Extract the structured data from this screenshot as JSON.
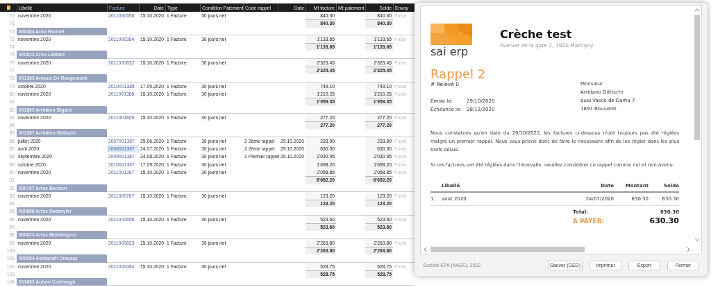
{
  "sheet": {
    "columns": [
      {
        "label": "Libellé",
        "sorted": false
      },
      {
        "label": "Facture",
        "sorted": true
      },
      {
        "label": "Date",
        "sorted": false
      },
      {
        "label": "Type",
        "sorted": false
      },
      {
        "label": "Condition Paiement",
        "sorted": false
      },
      {
        "label": "Code rappel",
        "sorted": false
      },
      {
        "label": "Date",
        "sorted": false
      },
      {
        "label": "Mt facture",
        "sorted": false
      },
      {
        "label": "Mt paiement",
        "sorted": false
      },
      {
        "label": "Solde",
        "sorted": false
      },
      {
        "label": "Envoy",
        "sorted": false
      }
    ],
    "rows": [
      {
        "number": "70",
        "kind": "invoice",
        "libelle": "novembre 2020",
        "facture": "2011000556",
        "date": "15.10.2020",
        "type": "1 Facture",
        "condition": "30 jours net",
        "mt_facture": "840.30",
        "solde": "840.30",
        "envoye": "Poste",
        "selected": false
      },
      {
        "number": "71",
        "kind": "total",
        "mt_facture": "840.30",
        "solde": "840.30"
      },
      {
        "number": "72",
        "kind": "group",
        "label": "000384 Arno Rouriet"
      },
      {
        "number": "73",
        "kind": "invoice",
        "libelle": "novembre 2020",
        "facture": "2011000384",
        "date": "15.10.2020",
        "type": "1 Facture",
        "condition": "30 jours net",
        "mt_facture": "1'133.65",
        "solde": "1'133.65",
        "envoye": "Poste",
        "selected": false
      },
      {
        "number": "74",
        "kind": "total",
        "mt_facture": "1'133.65",
        "solde": "1'133.65"
      },
      {
        "number": "75",
        "kind": "group",
        "label": "000832 Arno Laillard"
      },
      {
        "number": "76",
        "kind": "invoice",
        "libelle": "novembre 2020",
        "facture": "2011000832",
        "date": "15.10.2020",
        "type": "1 Facture",
        "condition": "30 jours net",
        "mt_facture": "2'325.45",
        "solde": "2'325.45",
        "envoye": "Poste",
        "selected": false
      },
      {
        "number": "77",
        "kind": "total",
        "mt_facture": "2'325.45",
        "solde": "2'325.45"
      },
      {
        "number": "78",
        "kind": "group",
        "label": "001385 Arnoux De Rougemont"
      },
      {
        "number": "79",
        "kind": "invoice",
        "libelle": "octobre 2020",
        "facture": "2010001385",
        "date": "17.09.2020",
        "type": "1 Facture",
        "condition": "30 jours net",
        "mt_facture": "749.10",
        "solde": "749.10",
        "envoye": "Poste",
        "selected": false
      },
      {
        "number": "80",
        "kind": "invoice",
        "libelle": "novembre 2020",
        "facture": "2011001385",
        "date": "15.10.2020",
        "type": "1 Facture",
        "condition": "30 jours net",
        "mt_facture": "1'210.25",
        "solde": "1'210.25",
        "envoye": "Poste",
        "selected": false
      },
      {
        "number": "81",
        "kind": "total",
        "mt_facture": "1'959.35",
        "solde": "1'959.35"
      },
      {
        "number": "82",
        "kind": "group",
        "label": "001809 Arridano Bigard"
      },
      {
        "number": "83",
        "kind": "invoice",
        "libelle": "novembre 2020",
        "facture": "2011001809",
        "date": "15.10.2020",
        "type": "1 Facture",
        "condition": "30 jours net",
        "mt_facture": "277.20",
        "solde": "277.20",
        "envoye": "Poste",
        "selected": false
      },
      {
        "number": "84",
        "kind": "total",
        "mt_facture": "277.20",
        "solde": "277.20"
      },
      {
        "number": "85",
        "kind": "group",
        "label": "001367 Arridano Göttschi"
      },
      {
        "number": "86",
        "kind": "invoice",
        "libelle": "juillet 2020",
        "facture": "2007001367",
        "date": "25.06.2020",
        "type": "1 Facture",
        "condition": "30 jours net",
        "code_rappel": "2 2ème rappel",
        "date_rappel": "29.10.2020",
        "mt_facture": "233.90",
        "solde": "233.90",
        "envoye": "Poste",
        "selected": false
      },
      {
        "number": "87",
        "kind": "invoice",
        "libelle": "août 2020",
        "facture": "2008001367",
        "date": "24.07.2020",
        "type": "1 Facture",
        "condition": "30 jours net",
        "code_rappel": "2 2ème rappel",
        "date_rappel": "29.10.2020",
        "mt_facture": "630.30",
        "solde": "630.30",
        "envoye": "Poste",
        "selected": true
      },
      {
        "number": "88",
        "kind": "invoice",
        "libelle": "septembre 2020",
        "facture": "2009001367",
        "date": "24.08.2020",
        "type": "1 Facture",
        "condition": "30 jours net",
        "code_rappel": "1 Premier rappel",
        "date_rappel": "29.10.2020",
        "mt_facture": "2'030.95",
        "solde": "2'030.95",
        "envoye": "Poste",
        "selected": false
      },
      {
        "number": "89",
        "kind": "invoice",
        "libelle": "octobre 2020",
        "facture": "2010001367",
        "date": "17.09.2020",
        "type": "1 Facture",
        "condition": "30 jours net",
        "mt_facture": "1'698.20",
        "solde": "1'698.20",
        "envoye": "Poste",
        "selected": false
      },
      {
        "number": "90",
        "kind": "invoice",
        "libelle": "novembre 2020",
        "facture": "2011001367",
        "date": "15.10.2020",
        "type": "1 Facture",
        "condition": "30 jours net",
        "mt_facture": "2'058.85",
        "solde": "2'058.85",
        "envoye": "Poste",
        "selected": false
      },
      {
        "number": "91",
        "kind": "total",
        "mt_facture": "6'652.20",
        "solde": "6'652.20"
      },
      {
        "number": "92",
        "kind": "group",
        "label": "000767 Artos Barbieri"
      },
      {
        "number": "93",
        "kind": "invoice",
        "libelle": "novembre 2020",
        "facture": "2011000767",
        "date": "15.10.2020",
        "type": "1 Facture",
        "condition": "30 jours net",
        "mt_facture": "123.20",
        "solde": "123.20",
        "envoye": "Poste",
        "selected": false
      },
      {
        "number": "94",
        "kind": "total",
        "mt_facture": "123.20",
        "solde": "123.20"
      },
      {
        "number": "95",
        "kind": "group",
        "label": "000698 Artos Daetwyler"
      },
      {
        "number": "96",
        "kind": "invoice",
        "libelle": "novembre 2020",
        "facture": "2011000698",
        "date": "15.10.2020",
        "type": "1 Facture",
        "condition": "30 jours net",
        "mt_facture": "523.60",
        "solde": "523.60",
        "envoye": "Poste",
        "selected": false
      },
      {
        "number": "97",
        "kind": "total",
        "mt_facture": "523.60",
        "solde": "523.60"
      },
      {
        "number": "98",
        "kind": "group",
        "label": "000823 Artos Montangero"
      },
      {
        "number": "99",
        "kind": "invoice",
        "libelle": "novembre 2020",
        "facture": "2011000823",
        "date": "15.10.2020",
        "type": "1 Facture",
        "condition": "30 jours net",
        "mt_facture": "2'263.80",
        "solde": "2'263.80",
        "envoye": "Poste",
        "selected": false
      },
      {
        "number": "100",
        "kind": "total",
        "mt_facture": "2'263.80",
        "solde": "2'263.80"
      },
      {
        "number": "101",
        "kind": "group",
        "label": "000084 Ashtaroth Crausaz"
      },
      {
        "number": "102",
        "kind": "invoice",
        "libelle": "novembre 2020",
        "facture": "2011000084",
        "date": "15.10.2020",
        "type": "1 Facture",
        "condition": "30 jours net",
        "mt_facture": "528.75",
        "solde": "528.75",
        "envoye": "Poste",
        "selected": false
      },
      {
        "number": "103",
        "kind": "total",
        "mt_facture": "528.75",
        "solde": "528.75"
      },
      {
        "number": "104",
        "kind": "group",
        "label": "001683 Aubert Colelough"
      }
    ]
  },
  "dialog": {
    "logo": {
      "text": "sai erp"
    },
    "document": {
      "company": "Crèche test",
      "address": "Avenue de la gare 2, 1920 Martigny",
      "title": "Rappel 2",
      "reference": "# Relevé 0",
      "dates": [
        {
          "label": "Émise le:",
          "value": "29/10/2020"
        },
        {
          "label": "Échéance le:",
          "value": "28/12/2020"
        }
      ],
      "recipient": [
        "Monsieur",
        "Arridano Göttschi",
        "quai Vasco de Gama 7",
        "1897 Bouveret"
      ],
      "paragraphs": [
        "Nous constatons qu'en date du 29/10/2020, les factures ci-dessous n'ont toujours pas été réglées malgré un premier rappel. Nous vous prions donc de faire le nécessaire afin de les régler dans les plus brefs délais.",
        "Si ces factures ont été réglées dans l'intervalle, veuillez considérer ce rappel comme nul et non avenu."
      ],
      "table": {
        "columns": [
          "Libellé",
          "Date",
          "Montant",
          "Solde"
        ],
        "rows": [
          {
            "index": "1.",
            "libelle": "août 2020",
            "date": "24/07/2020",
            "montant": "630.30",
            "solde": "630.30"
          }
        ]
      },
      "total_label": "Total:",
      "total": "630.30",
      "pay_label": "A PAYER:",
      "pay_amount": "630.30"
    },
    "footer": "Société EPA (AAEE), 2022",
    "buttons": [
      "Sauver (GED)",
      "Imprimer",
      "Export",
      "Fermer"
    ]
  }
}
